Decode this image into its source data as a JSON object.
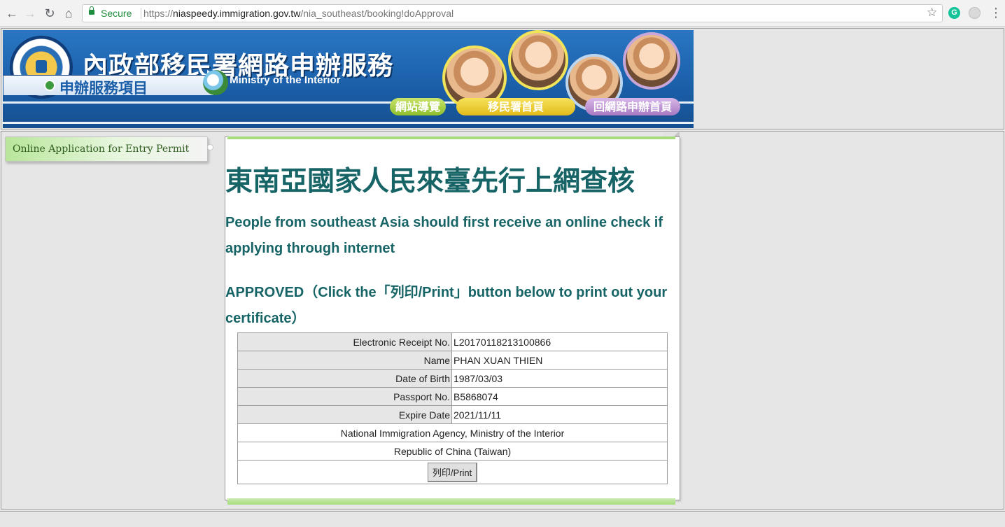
{
  "browser": {
    "secure_label": "Secure",
    "url_protocol": "https://",
    "url_host": "niaspeedy.immigration.gov.tw",
    "url_path": "/nia_southeast/booking!doApproval",
    "icons": [
      "back-icon",
      "forward-icon",
      "reload-icon",
      "home-icon",
      "lock-icon",
      "star-icon",
      "grammarly-icon",
      "extension-icon",
      "menu-icon"
    ]
  },
  "banner": {
    "title_zh": "內政部移民署網路申辦服務",
    "title_en": "National Immigration Agency Ministry of the Interior",
    "service_tab": "申辦服務項目",
    "nav": [
      "網站導覽",
      "移民署首頁",
      "回網路申辦首頁"
    ],
    "colors": {
      "banner_blue": "#1a5ea8",
      "accent_teal": "#176466",
      "menu_green": "#b8e69a"
    }
  },
  "sidebar": {
    "items": [
      {
        "label": "Online Application for Entry Permit"
      }
    ]
  },
  "content": {
    "heading_zh": "東南亞國家人民來臺先行上網查核",
    "heading_en": "People from southeast Asia should first receive an online check if applying through internet",
    "status": "APPROVED（Click the「列印/Print」button below to print out your certificate）",
    "table": {
      "rows": [
        {
          "label": "Electronic Receipt No.",
          "value": "L20170118213100866"
        },
        {
          "label": "Name",
          "value": "PHAN XUAN THIEN"
        },
        {
          "label": "Date of Birth",
          "value": "1987/03/03"
        },
        {
          "label": "Passport No.",
          "value": "B5868074"
        },
        {
          "label": "Expire Date",
          "value": "2021/11/11"
        }
      ],
      "footer_lines": [
        "National Immigration Agency, Ministry of the Interior",
        "Republic of China (Taiwan)"
      ],
      "print_button": "列印/Print"
    }
  }
}
